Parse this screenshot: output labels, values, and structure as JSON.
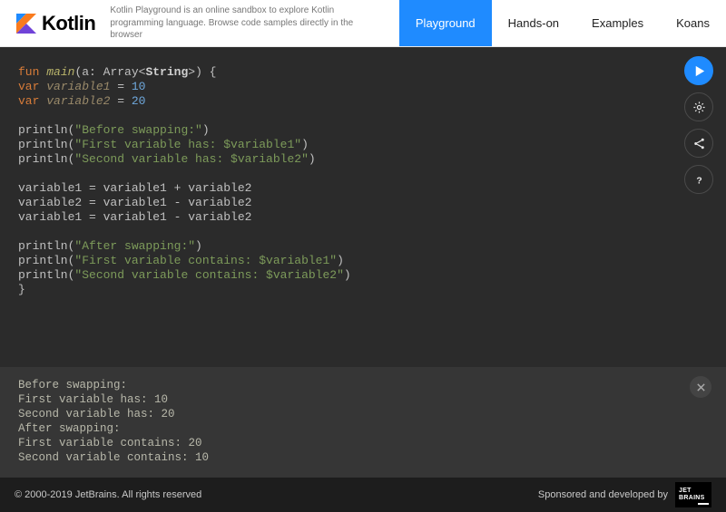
{
  "header": {
    "brand": "Kotlin",
    "tagline": "Kotlin Playground is an online sandbox to explore Kotlin programming language. Browse code samples directly in the browser",
    "nav": [
      {
        "label": "Playground",
        "active": true
      },
      {
        "label": "Hands-on",
        "active": false
      },
      {
        "label": "Examples",
        "active": false
      },
      {
        "label": "Koans",
        "active": false
      }
    ]
  },
  "code": {
    "tokens": [
      [
        [
          "kw",
          "fun"
        ],
        [
          "punc",
          " "
        ],
        [
          "fn",
          "main"
        ],
        [
          "punc",
          "(a: Array<"
        ],
        [
          "typ",
          "String"
        ],
        [
          "punc",
          ">) {"
        ]
      ],
      [
        [
          "kw",
          "var"
        ],
        [
          "punc",
          " "
        ],
        [
          "var",
          "variable1"
        ],
        [
          "punc",
          " = "
        ],
        [
          "num",
          "10"
        ]
      ],
      [
        [
          "kw",
          "var"
        ],
        [
          "punc",
          " "
        ],
        [
          "var",
          "variable2"
        ],
        [
          "punc",
          " = "
        ],
        [
          "num",
          "20"
        ]
      ],
      [],
      [
        [
          "punc",
          "println("
        ],
        [
          "str",
          "\"Before swapping:\""
        ],
        [
          "punc",
          ")"
        ]
      ],
      [
        [
          "punc",
          "println("
        ],
        [
          "str",
          "\"First variable has: $variable1\""
        ],
        [
          "punc",
          ")"
        ]
      ],
      [
        [
          "punc",
          "println("
        ],
        [
          "str",
          "\"Second variable has: $variable2\""
        ],
        [
          "punc",
          ")"
        ]
      ],
      [],
      [
        [
          "punc",
          "variable1 = variable1 + variable2"
        ]
      ],
      [
        [
          "punc",
          "variable2 = variable1 - variable2"
        ]
      ],
      [
        [
          "punc",
          "variable1 = variable1 - variable2"
        ]
      ],
      [],
      [
        [
          "punc",
          "println("
        ],
        [
          "str",
          "\"After swapping:\""
        ],
        [
          "punc",
          ")"
        ]
      ],
      [
        [
          "punc",
          "println("
        ],
        [
          "str",
          "\"First variable contains: $variable1\""
        ],
        [
          "punc",
          ")"
        ]
      ],
      [
        [
          "punc",
          "println("
        ],
        [
          "str",
          "\"Second variable contains: $variable2\""
        ],
        [
          "punc",
          ")"
        ]
      ],
      [
        [
          "punc",
          "}"
        ]
      ]
    ]
  },
  "console": {
    "lines": [
      "Before swapping:",
      "First variable has: 10",
      "Second variable has: 20",
      "After swapping:",
      "First variable contains: 20",
      "Second variable contains: 10"
    ]
  },
  "footer": {
    "copyright": "© 2000-2019 JetBrains. All rights reserved",
    "sponsored": "Sponsored and developed by",
    "jb1": "JET",
    "jb2": "BRAINS"
  },
  "icons": {
    "run": "play-icon",
    "settings": "gear-icon",
    "share": "share-icon",
    "help": "help-icon",
    "close": "close-icon"
  }
}
